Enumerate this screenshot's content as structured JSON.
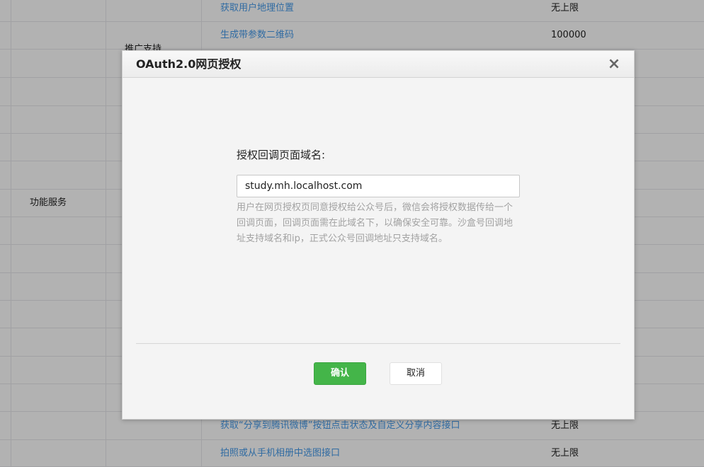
{
  "background": {
    "category_label": "功能服务",
    "subcategory_label": "推广支持",
    "rows": [
      {
        "name": "获取用户地理位置",
        "limit": "无上限"
      },
      {
        "name": "生成带参数二维码",
        "limit": "100000"
      },
      {
        "name": "获取“分享到腾讯微博”按钮点击状态及自定义分享内容接口",
        "limit": "无上限"
      },
      {
        "name": "拍照或从手机相册中选图接口",
        "limit": "无上限"
      }
    ]
  },
  "dialog": {
    "title": "OAuth2.0网页授权",
    "close_icon": "×",
    "field_label": "授权回调页面域名:",
    "field_value": "study.mh.localhost.com",
    "description": "用户在网页授权页同意授权给公众号后，微信会将授权数据传给一个回调页面，回调页面需在此域名下，以确保安全可靠。沙盒号回调地址支持域名和ip，正式公众号回调地址只支持域名。",
    "confirm_label": "确认",
    "cancel_label": "取消"
  },
  "colors": {
    "link": "#459ae9",
    "primary_button": "#44b549"
  }
}
